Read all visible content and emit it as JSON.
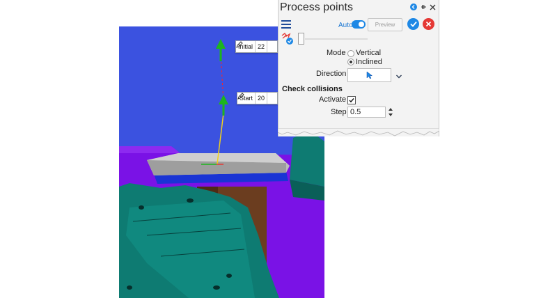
{
  "panel": {
    "title": "Process points",
    "auto_label": "Auto",
    "auto_enabled": true,
    "preview_label": "Preview",
    "mode": {
      "label": "Mode",
      "options": [
        "Vertical",
        "Inclined"
      ],
      "selected": "Inclined"
    },
    "direction": {
      "label": "Direction"
    },
    "check_collisions": {
      "heading": "Check collisions",
      "activate_label": "Activate",
      "activate_checked": true,
      "step_label": "Step",
      "step_value": "0.5"
    }
  },
  "viewport": {
    "tags": [
      {
        "label": "Initial",
        "value": "22"
      },
      {
        "label": "Start",
        "value": "20"
      }
    ],
    "colors": {
      "background": "#3b52e0",
      "purple_part": "#7a12e6",
      "teal_part": "#0e7b72",
      "plate": "#bdbdbd",
      "column": "#6b3d1f"
    }
  },
  "colors": {
    "accent": "#1e88e5",
    "cancel": "#e53935",
    "panel_bg": "#f3f3f3"
  }
}
